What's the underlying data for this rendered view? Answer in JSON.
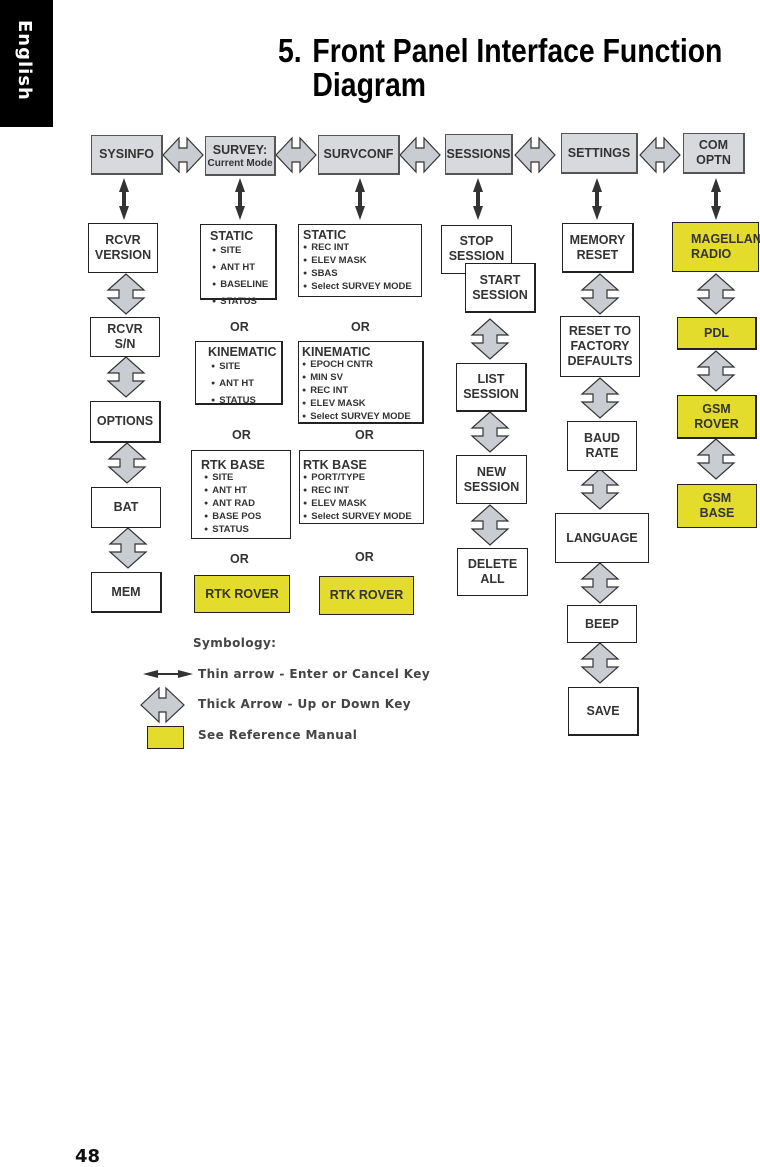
{
  "side_tab": {
    "label": "English"
  },
  "title": {
    "number": "5.",
    "line1": "Front Panel Interface Function",
    "line2": "Diagram"
  },
  "top_menu": [
    {
      "id": "sysinfo",
      "label": "SYSINFO"
    },
    {
      "id": "survey",
      "label": "SURVEY:",
      "sublabel": "Current Mode"
    },
    {
      "id": "survconf",
      "label": "SURVCONF"
    },
    {
      "id": "sessions",
      "label": "SESSIONS"
    },
    {
      "id": "settings",
      "label": "SETTINGS"
    },
    {
      "id": "comoptn",
      "label": "COM\nOPTN"
    }
  ],
  "sysinfo_column": [
    "RCVR\nVERSION",
    "RCVR\nS/N",
    "OPTIONS",
    "BAT",
    "MEM"
  ],
  "survey_column": {
    "static": {
      "heading": "STATIC",
      "items": [
        "SITE",
        "ANT HT",
        "BASELINE",
        "STATUS"
      ]
    },
    "kinematic": {
      "heading": "KINEMATIC",
      "items": [
        "SITE",
        "ANT HT",
        "STATUS"
      ]
    },
    "rtk_base": {
      "heading": "RTK BASE",
      "items": [
        "SITE",
        "ANT HT",
        "ANT RAD",
        "BASE POS",
        "STATUS"
      ]
    },
    "rtk_rover": "RTK ROVER"
  },
  "survconf_column": {
    "static": {
      "heading": "STATIC",
      "items": [
        "REC INT",
        "ELEV MASK",
        "SBAS",
        "Select SURVEY MODE"
      ]
    },
    "kinematic": {
      "heading": "KINEMATIC",
      "items": [
        "EPOCH CNTR",
        "MIN SV",
        "REC INT",
        "ELEV MASK",
        "Select SURVEY MODE"
      ]
    },
    "rtk_base": {
      "heading": "RTK BASE",
      "items": [
        "PORT/TYPE",
        "REC INT",
        "ELEV MASK",
        "Select SURVEY MODE"
      ]
    },
    "rtk_rover": "RTK ROVER"
  },
  "or_label": "OR",
  "sessions_column": [
    "STOP\nSESSION",
    "START\nSESSION",
    "LIST\nSESSION",
    "NEW\nSESSION",
    "DELETE\nALL"
  ],
  "settings_column": [
    "MEMORY\nRESET",
    "RESET TO\nFACTORY\nDEFAULTS",
    "BAUD\nRATE",
    "LANGUAGE",
    "BEEP",
    "SAVE"
  ],
  "comoptn_column": [
    "MAGELLAN\nRADIO",
    "PDL",
    "GSM\nROVER",
    "GSM\nBASE"
  ],
  "legend": {
    "title": "Symbology:",
    "thin_arrow": "Thin arrow - Enter or Cancel Key",
    "thick_arrow": "Thick Arrow - Up or Down Key",
    "yellow_box": "See Reference Manual"
  },
  "colors": {
    "menu_grey": "#d8d9dc",
    "reference_yellow": "#e4dc2c",
    "arrow_grey": "#c9ccd1"
  },
  "page_number": "48"
}
